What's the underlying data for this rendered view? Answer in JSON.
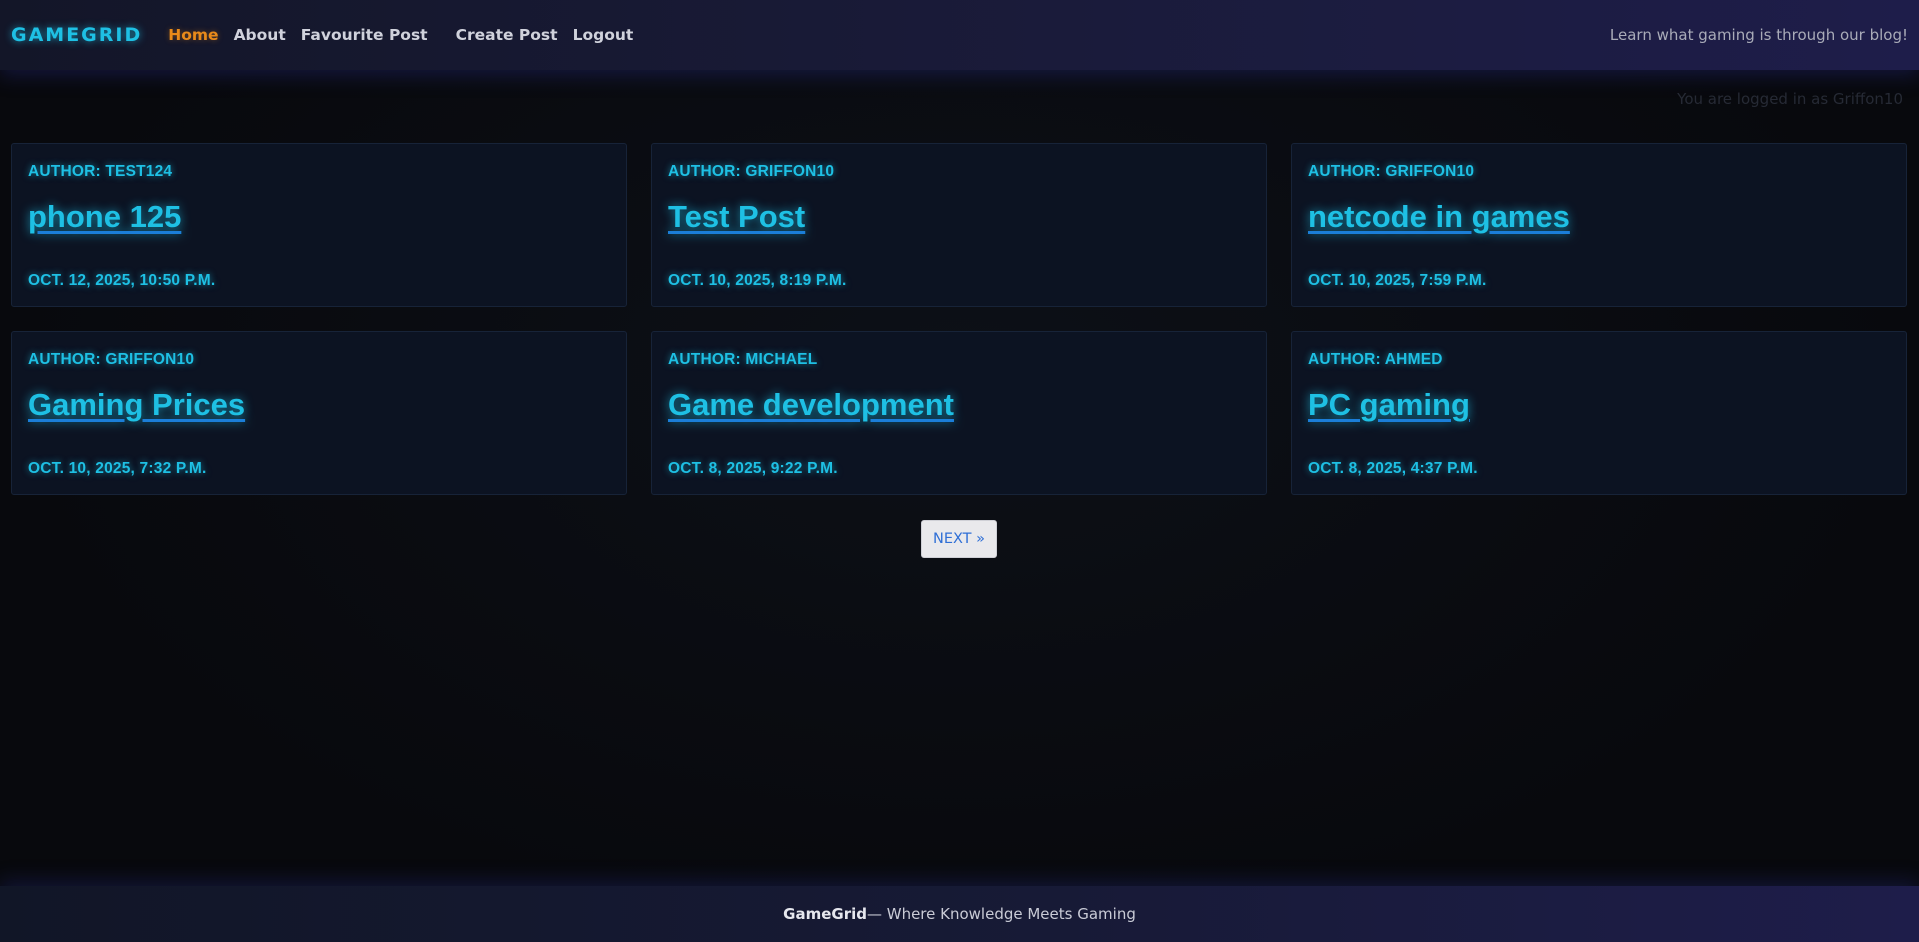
{
  "navbar": {
    "brand": "GAMEGRID",
    "links": [
      {
        "label": "Home",
        "active": true
      },
      {
        "label": "About"
      },
      {
        "label": "Favourite Post"
      },
      {
        "label": "Create Post"
      },
      {
        "label": "Logout"
      }
    ],
    "tagline": "Learn what gaming is through our blog!"
  },
  "status": {
    "logged_in_text": "You are logged in as Griffon10"
  },
  "posts": [
    {
      "author": "Author: test124",
      "title": "phone 125",
      "date": "Oct. 12, 2025, 10:50 p.m."
    },
    {
      "author": "Author: Griffon10",
      "title": "Test Post",
      "date": "Oct. 10, 2025, 8:19 p.m."
    },
    {
      "author": "Author: Griffon10",
      "title": "netcode in games",
      "date": "Oct. 10, 2025, 7:59 p.m."
    },
    {
      "author": "Author: Griffon10",
      "title": "Gaming Prices",
      "date": "Oct. 10, 2025, 7:32 p.m."
    },
    {
      "author": "Author: Michael",
      "title": "Game development",
      "date": "Oct. 8, 2025, 9:22 p.m."
    },
    {
      "author": "Author: ahmed",
      "title": "PC gaming",
      "date": "Oct. 8, 2025, 4:37 p.m."
    }
  ],
  "pagination": {
    "next_label": "NEXT »"
  },
  "footer": {
    "brand": "GameGrid",
    "text": " — Where Knowledge Meets Gaming"
  },
  "colors": {
    "accent_cyan": "#1ec0e4",
    "active_orange": "#e88a1a",
    "background": "#08090d"
  }
}
